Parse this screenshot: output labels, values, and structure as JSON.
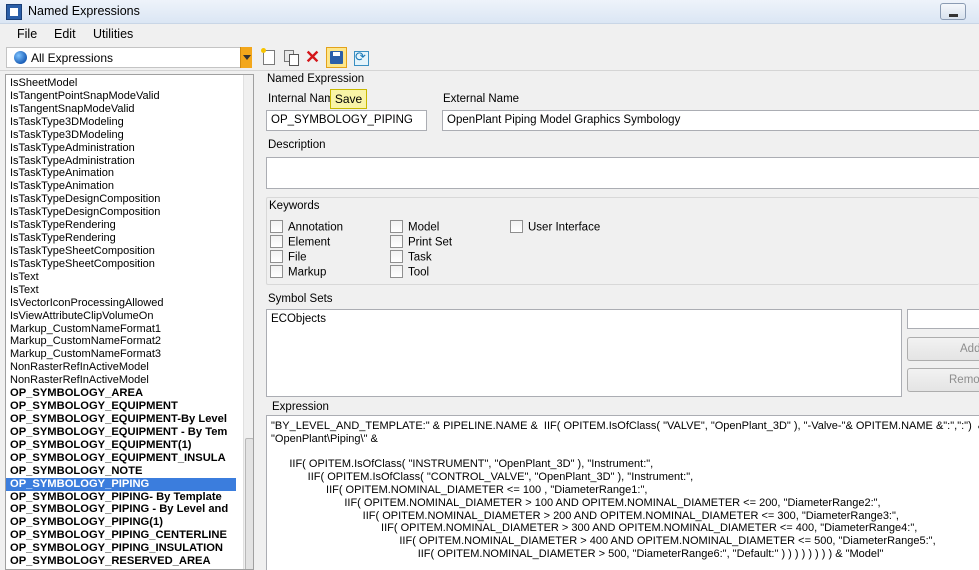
{
  "window": {
    "title": "Named Expressions"
  },
  "menu": [
    "File",
    "Edit",
    "Utilities"
  ],
  "toolbar": {
    "scope_value": "All Expressions",
    "save_tooltip": "Save"
  },
  "list": {
    "items": [
      {
        "label": "IsSheetModel",
        "bold": false
      },
      {
        "label": "IsTangentPointSnapModeValid",
        "bold": false
      },
      {
        "label": "IsTangentSnapModeValid",
        "bold": false
      },
      {
        "label": "IsTaskType3DModeling",
        "bold": false
      },
      {
        "label": "IsTaskType3DModeling",
        "bold": false
      },
      {
        "label": "IsTaskTypeAdministration",
        "bold": false
      },
      {
        "label": "IsTaskTypeAdministration",
        "bold": false
      },
      {
        "label": "IsTaskTypeAnimation",
        "bold": false
      },
      {
        "label": "IsTaskTypeAnimation",
        "bold": false
      },
      {
        "label": "IsTaskTypeDesignComposition",
        "bold": false
      },
      {
        "label": "IsTaskTypeDesignComposition",
        "bold": false
      },
      {
        "label": "IsTaskTypeRendering",
        "bold": false
      },
      {
        "label": "IsTaskTypeRendering",
        "bold": false
      },
      {
        "label": "IsTaskTypeSheetComposition",
        "bold": false
      },
      {
        "label": "IsTaskTypeSheetComposition",
        "bold": false
      },
      {
        "label": "IsText",
        "bold": false
      },
      {
        "label": "IsText",
        "bold": false
      },
      {
        "label": "IsVectorIconProcessingAllowed",
        "bold": false
      },
      {
        "label": "IsViewAttributeClipVolumeOn",
        "bold": false
      },
      {
        "label": "Markup_CustomNameFormat1",
        "bold": false
      },
      {
        "label": "Markup_CustomNameFormat2",
        "bold": false
      },
      {
        "label": "Markup_CustomNameFormat3",
        "bold": false
      },
      {
        "label": "NonRasterRefInActiveModel",
        "bold": false
      },
      {
        "label": "NonRasterRefInActiveModel",
        "bold": false
      },
      {
        "label": "OP_SYMBOLOGY_AREA",
        "bold": true
      },
      {
        "label": "OP_SYMBOLOGY_EQUIPMENT",
        "bold": true
      },
      {
        "label": "OP_SYMBOLOGY_EQUIPMENT-By Level",
        "bold": true
      },
      {
        "label": "OP_SYMBOLOGY_EQUIPMENT - By Tem",
        "bold": true
      },
      {
        "label": "OP_SYMBOLOGY_EQUIPMENT(1)",
        "bold": true
      },
      {
        "label": "OP_SYMBOLOGY_EQUIPMENT_INSULA",
        "bold": true
      },
      {
        "label": "OP_SYMBOLOGY_NOTE",
        "bold": true
      },
      {
        "label": "OP_SYMBOLOGY_PIPING",
        "bold": true,
        "selected": true
      },
      {
        "label": "OP_SYMBOLOGY_PIPING- By Template",
        "bold": true
      },
      {
        "label": "OP_SYMBOLOGY_PIPING - By Level and",
        "bold": true
      },
      {
        "label": "OP_SYMBOLOGY_PIPING(1)",
        "bold": true
      },
      {
        "label": "OP_SYMBOLOGY_PIPING_CENTERLINE",
        "bold": true
      },
      {
        "label": "OP_SYMBOLOGY_PIPING_INSULATION",
        "bold": true
      },
      {
        "label": "OP_SYMBOLOGY_RESERVED_AREA",
        "bold": true
      }
    ]
  },
  "detail": {
    "heading": "Named Expression",
    "internal_name_label": "Internal Nam",
    "internal_name_value": "OP_SYMBOLOGY_PIPING",
    "external_name_label": "External Name",
    "external_name_value": "OpenPlant Piping Model Graphics Symbology",
    "description_label": "Description",
    "description_value": "",
    "keywords_label": "Keywords",
    "keywords": [
      "Annotation",
      "Element",
      "File",
      "Markup",
      "Model",
      "Print Set",
      "Task",
      "Tool",
      "User Interface"
    ],
    "symbol_sets_label": "Symbol Sets",
    "symbol_sets": [
      "ECObjects"
    ],
    "add_label": "Add",
    "remove_label": "Remove",
    "expression_label": "Expression",
    "expression_text": "\"BY_LEVEL_AND_TEMPLATE:\" & PIPELINE.NAME &  IIF( OPITEM.IsOfClass( \"VALVE\", \"OpenPlant_3D\" ), \"-Valve-\"& OPITEM.NAME &\":\",\":\")  &\n\"OpenPlant\\Piping\\\" &\n\n      IIF( OPITEM.IsOfClass( \"INSTRUMENT\", \"OpenPlant_3D\" ), \"Instrument:\",\n            IIF( OPITEM.IsOfClass( \"CONTROL_VALVE\", \"OpenPlant_3D\" ), \"Instrument:\",\n                  IIF( OPITEM.NOMINAL_DIAMETER <= 100 , \"DiameterRange1:\",\n                        IIF( OPITEM.NOMINAL_DIAMETER > 100 AND OPITEM.NOMINAL_DIAMETER <= 200, \"DiameterRange2:\",\n                              IIF( OPITEM.NOMINAL_DIAMETER > 200 AND OPITEM.NOMINAL_DIAMETER <= 300, \"DiameterRange3:\",\n                                    IIF( OPITEM.NOMINAL_DIAMETER > 300 AND OPITEM.NOMINAL_DIAMETER <= 400, \"DiameterRange4:\",\n                                          IIF( OPITEM.NOMINAL_DIAMETER > 400 AND OPITEM.NOMINAL_DIAMETER <= 500, \"DiameterRange5:\",\n                                                IIF( OPITEM.NOMINAL_DIAMETER > 500, \"DiameterRange6:\", \"Default:\" ) ) ) ) ) ) ) ) & \"Model\""
  }
}
